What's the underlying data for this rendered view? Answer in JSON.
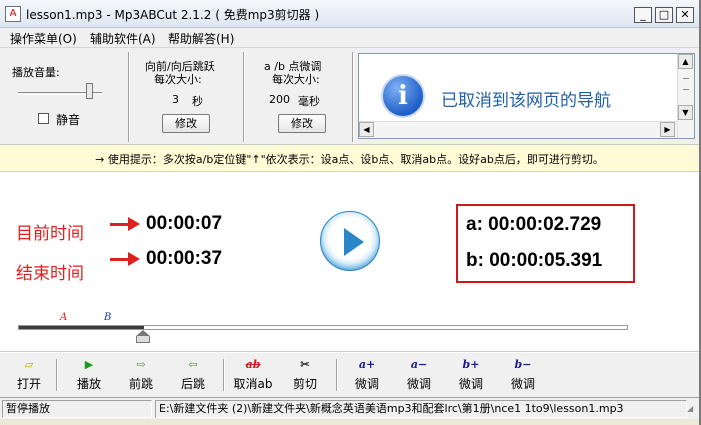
{
  "window": {
    "title": "lesson1.mp3 - Mp3ABCut 2.1.2 ( 免费mp3剪切器 )",
    "icon_letter": "A"
  },
  "menu": [
    "操作菜单(O)",
    "辅助软件(A)",
    "帮助解答(H)"
  ],
  "volume": {
    "label": "播放音量:",
    "mute_label": "静音",
    "level": 0.85
  },
  "skip": {
    "title_line1": "向前/向后跳跃",
    "title_line2": "每次大小:",
    "value": "3",
    "unit": "秒",
    "modify_label": "修改"
  },
  "fine": {
    "title_line1": "a /b 点微调",
    "title_line2": "每次大小:",
    "value": "200",
    "unit": "毫秒",
    "modify_label": "修改"
  },
  "browser": {
    "message": "已取消到该网页的导航",
    "icon_glyph": "i"
  },
  "tip": "→ 使用提示：多次按a/b定位键\"↑\"依次表示：设a点、设b点、取消ab点。设好ab点后，即可进行剪切。",
  "playback": {
    "current_label": "目前时间",
    "current_time": "00:00:07",
    "end_label": "结束时间",
    "end_time": "00:00:37",
    "a_point": "a: 00:00:02.729",
    "b_point": "b: 00:00:05.391"
  },
  "timeline": {
    "marker_a": "A",
    "marker_b": "B",
    "a_fraction": 0.073,
    "b_fraction": 0.146,
    "played_fraction": 0.205
  },
  "toolbar": [
    {
      "icon": "▱",
      "label": "打开",
      "name": "open"
    },
    {
      "icon": "▶",
      "label": "播放",
      "name": "play"
    },
    {
      "icon": "⇨",
      "label": "前跳",
      "name": "forward"
    },
    {
      "icon": "⇦",
      "label": "后跳",
      "name": "back"
    },
    {
      "icon": "ab",
      "label": "取消ab",
      "name": "cancel-ab"
    },
    {
      "icon": "✂",
      "label": "剪切",
      "name": "cut"
    },
    {
      "icon": "a+",
      "label": "微调",
      "name": "a-plus"
    },
    {
      "icon": "a−",
      "label": "微调",
      "name": "a-minus"
    },
    {
      "icon": "b+",
      "label": "微调",
      "name": "b-plus"
    },
    {
      "icon": "b−",
      "label": "微调",
      "name": "b-minus"
    }
  ],
  "status": {
    "state": "暂停播放",
    "path": "E:\\新建文件夹 (2)\\新建文件夹\\新概念英语美语mp3和配套lrc\\第1册\\nce1 1to9\\lesson1.mp3"
  },
  "colors": {
    "accent_red": "#e0201e",
    "play_blue": "#2a86c7",
    "tip_bg": "#fffbd6"
  }
}
